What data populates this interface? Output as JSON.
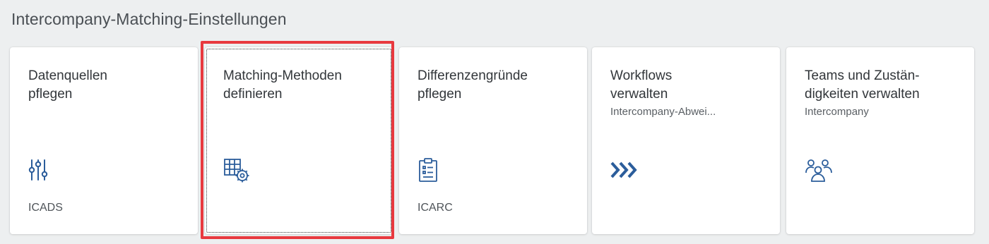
{
  "group": {
    "title": "Intercompany-Matching-Einstellungen"
  },
  "tiles": [
    {
      "title": "Datenquellen\npflegen",
      "subtitle": "",
      "footer": "ICADS",
      "icon": "sliders-icon"
    },
    {
      "title": "Matching-Methoden\ndefinieren",
      "subtitle": "",
      "footer": "",
      "icon": "table-settings-icon"
    },
    {
      "title": "Differenzengründe\npflegen",
      "subtitle": "",
      "footer": "ICARC",
      "icon": "clipboard-list-icon"
    },
    {
      "title": "Workflows\nverwalten",
      "subtitle": "Intercompany-Abwei...",
      "footer": "",
      "icon": "workflow-chevrons-icon"
    },
    {
      "title": "Teams und Zustän-\ndigkeiten verwalten",
      "subtitle": "Intercompany",
      "footer": "",
      "icon": "group-people-icon"
    }
  ],
  "colors": {
    "icon_accent": "#2b5d9b",
    "highlight": "#e8393f",
    "background": "#edeff0"
  }
}
